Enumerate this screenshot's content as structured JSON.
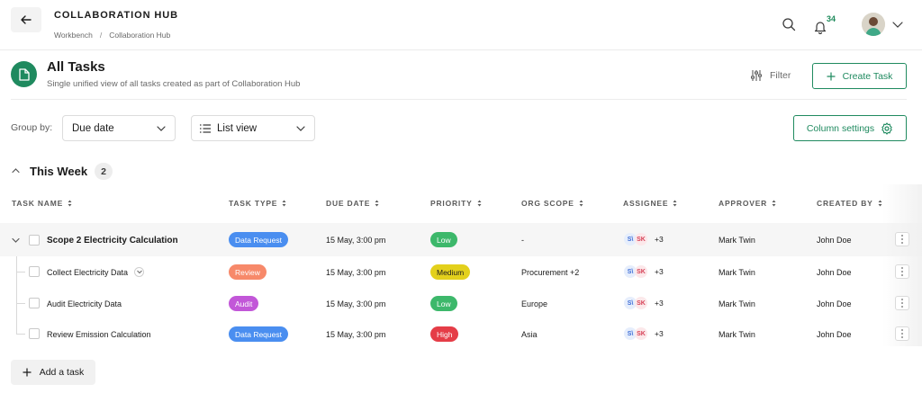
{
  "header": {
    "title": "COLLABORATION HUB",
    "breadcrumb": [
      "Workbench",
      "Collaboration Hub"
    ],
    "notification_count": "34"
  },
  "page": {
    "title": "All Tasks",
    "subtitle": "Single unified view of all tasks created as part of Collaboration Hub",
    "filter_label": "Filter",
    "create_label": "Create Task"
  },
  "toolbar": {
    "group_by_label": "Group by:",
    "group_by_value": "Due date",
    "view_value": "List view",
    "column_settings_label": "Column settings"
  },
  "group": {
    "title": "This Week",
    "count": "2"
  },
  "columns": [
    "TASK NAME",
    "TASK TYPE",
    "DUE DATE",
    "PRIORITY",
    "ORG SCOPE",
    "ASSIGNEE",
    "APPROVER",
    "CREATED BY"
  ],
  "rows": [
    {
      "name": "Scope 2 Electricity Calculation",
      "type": "Data Request",
      "due": "15 May, 3:00 pm",
      "priority": "Low",
      "scope": "-",
      "assignee_initials": [
        "S\\",
        "SK"
      ],
      "assignee_more": "+3",
      "approver": "Mark Twin",
      "created_by": "John Doe"
    },
    {
      "name": "Collect Electricity Data",
      "type": "Review",
      "due": "15 May, 3:00 pm",
      "priority": "Medium",
      "scope": "Procurement +2",
      "assignee_initials": [
        "S\\",
        "SK"
      ],
      "assignee_more": "+3",
      "approver": "Mark Twin",
      "created_by": "John Doe"
    },
    {
      "name": "Audit Electricity Data",
      "type": "Audit",
      "due": "15 May, 3:00 pm",
      "priority": "Low",
      "scope": "Europe",
      "assignee_initials": [
        "S\\",
        "SK"
      ],
      "assignee_more": "+3",
      "approver": "Mark Twin",
      "created_by": "John Doe"
    },
    {
      "name": "Review Emission Calculation",
      "type": "Data Request",
      "due": "15 May, 3:00 pm",
      "priority": "High",
      "scope": "Asia",
      "assignee_initials": [
        "S\\",
        "SK"
      ],
      "assignee_more": "+3",
      "approver": "Mark Twin",
      "created_by": "John Doe"
    }
  ],
  "add_task_label": "Add a task",
  "colors": {
    "accent": "#1f8a5f",
    "type_data_request": "#4a8ef0",
    "type_review": "#f7896a",
    "type_audit": "#c257d8",
    "priority_low": "#3db86b",
    "priority_medium": "#e3d01c",
    "priority_high": "#e53d47"
  }
}
